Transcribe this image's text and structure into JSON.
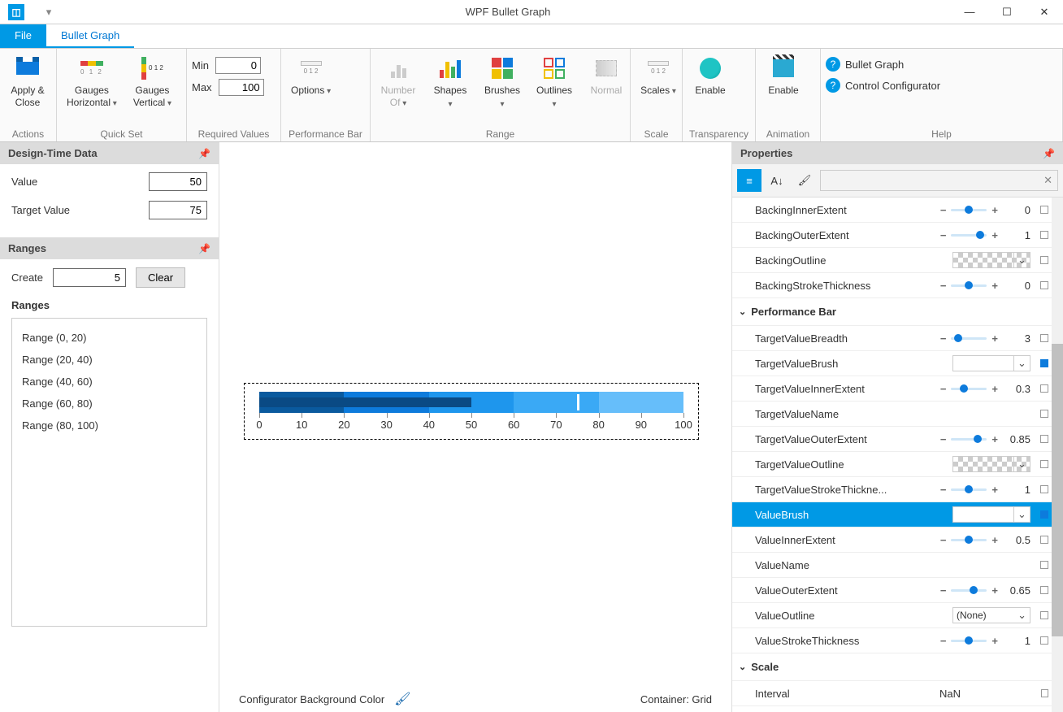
{
  "title": "WPF Bullet Graph",
  "tabs": {
    "file": "File",
    "bullet": "Bullet Graph"
  },
  "ribbon": {
    "actions": {
      "apply_close": "Apply &\nClose",
      "label": "Actions"
    },
    "quickset": {
      "gauges_h": "Gauges\nHorizontal",
      "gauges_v": "Gauges\nVertical",
      "label": "Quick Set"
    },
    "required": {
      "min_label": "Min",
      "min": "0",
      "max_label": "Max",
      "max": "100",
      "label": "Required Values"
    },
    "perfbar": {
      "options": "Options",
      "label": "Performance Bar"
    },
    "range": {
      "number_of": "Number\nOf",
      "shapes": "Shapes",
      "brushes": "Brushes",
      "outlines": "Outlines",
      "normal": "Normal",
      "label": "Range"
    },
    "scale": {
      "scales": "Scales",
      "label": "Scale"
    },
    "transparency": {
      "enable": "Enable",
      "label": "Transparency"
    },
    "animation": {
      "enable": "Enable",
      "label": "Animation"
    },
    "help": {
      "bullet": "Bullet Graph",
      "config": "Control Configurator",
      "label": "Help"
    }
  },
  "design_time": {
    "title": "Design-Time Data",
    "value_label": "Value",
    "value": "50",
    "target_label": "Target Value",
    "target": "75"
  },
  "ranges_panel": {
    "title": "Ranges",
    "create_label": "Create",
    "create_value": "5",
    "clear": "Clear",
    "list_label": "Ranges",
    "items": [
      "Range (0, 20)",
      "Range (20, 40)",
      "Range (40, 60)",
      "Range (60, 80)",
      "Range (80, 100)"
    ]
  },
  "center_footer": {
    "bg_label": "Configurator Background Color",
    "container": "Container: Grid"
  },
  "chart_data": {
    "type": "bullet",
    "min": 0,
    "max": 100,
    "value": 50,
    "target": 75,
    "ticks": [
      0,
      10,
      20,
      30,
      40,
      50,
      60,
      70,
      80,
      90,
      100
    ],
    "ranges": [
      {
        "from": 0,
        "to": 20,
        "color": "#0a5a9e"
      },
      {
        "from": 20,
        "to": 40,
        "color": "#0d7bdc"
      },
      {
        "from": 40,
        "to": 60,
        "color": "#1e96ed"
      },
      {
        "from": 60,
        "to": 80,
        "color": "#3aa9f5"
      },
      {
        "from": 80,
        "to": 100,
        "color": "#66befa"
      }
    ]
  },
  "properties": {
    "title": "Properties",
    "rows": [
      {
        "name": "BackingInnerExtent",
        "type": "slider",
        "value": "0",
        "knob": 0.5
      },
      {
        "name": "BackingOuterExtent",
        "type": "slider",
        "value": "1",
        "knob": 0.9
      },
      {
        "name": "BackingOutline",
        "type": "swatch",
        "checker": true
      },
      {
        "name": "BackingStrokeThickness",
        "type": "slider",
        "value": "0",
        "knob": 0.5
      }
    ],
    "section": "Performance Bar",
    "rows2": [
      {
        "name": "TargetValueBreadth",
        "type": "slider",
        "value": "3",
        "knob": 0.1
      },
      {
        "name": "TargetValueBrush",
        "type": "swatch",
        "checker": false,
        "blue": true
      },
      {
        "name": "TargetValueInnerExtent",
        "type": "slider",
        "value": "0.3",
        "knob": 0.3
      },
      {
        "name": "TargetValueName",
        "type": "blank"
      },
      {
        "name": "TargetValueOuterExtent",
        "type": "slider",
        "value": "0.85",
        "knob": 0.8
      },
      {
        "name": "TargetValueOutline",
        "type": "swatch",
        "checker": true
      },
      {
        "name": "TargetValueStrokeThickne...",
        "type": "slider",
        "value": "1",
        "knob": 0.5
      },
      {
        "name": "ValueBrush",
        "type": "swatch",
        "checker": false,
        "blue": true,
        "selected": true
      },
      {
        "name": "ValueInnerExtent",
        "type": "slider",
        "value": "0.5",
        "knob": 0.5
      },
      {
        "name": "ValueName",
        "type": "blank"
      },
      {
        "name": "ValueOuterExtent",
        "type": "slider",
        "value": "0.65",
        "knob": 0.65
      },
      {
        "name": "ValueOutline",
        "type": "dropdown",
        "value": "(None)"
      },
      {
        "name": "ValueStrokeThickness",
        "type": "slider",
        "value": "1",
        "knob": 0.5
      }
    ],
    "section2": "Scale",
    "rows3": [
      {
        "name": "Interval",
        "type": "text",
        "value": "NaN"
      }
    ]
  }
}
